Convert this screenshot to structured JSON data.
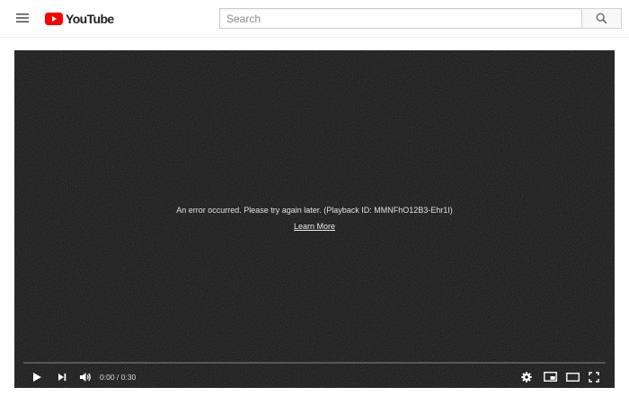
{
  "header": {
    "logo_text": "YouTube",
    "search_placeholder": "Search",
    "icons": {
      "menu": "hamburger-menu-icon",
      "logo": "youtube-play-icon",
      "search": "magnifier-icon"
    },
    "brand_color": "#ff0000"
  },
  "player": {
    "error_message": "An error occurred. Please try again later. (Playback ID: MMNFhO12B3-Ehr1I)",
    "learn_more_label": "Learn More",
    "time_display": "0:00 / 0:30",
    "progress_fraction": 0,
    "controls": [
      "play-icon",
      "next-icon",
      "volume-icon",
      "settings-gear-icon",
      "miniplayer-icon",
      "theater-mode-icon",
      "fullscreen-icon"
    ]
  },
  "colors": {
    "player_bg": "#121212",
    "control_icon": "#ffffff"
  }
}
